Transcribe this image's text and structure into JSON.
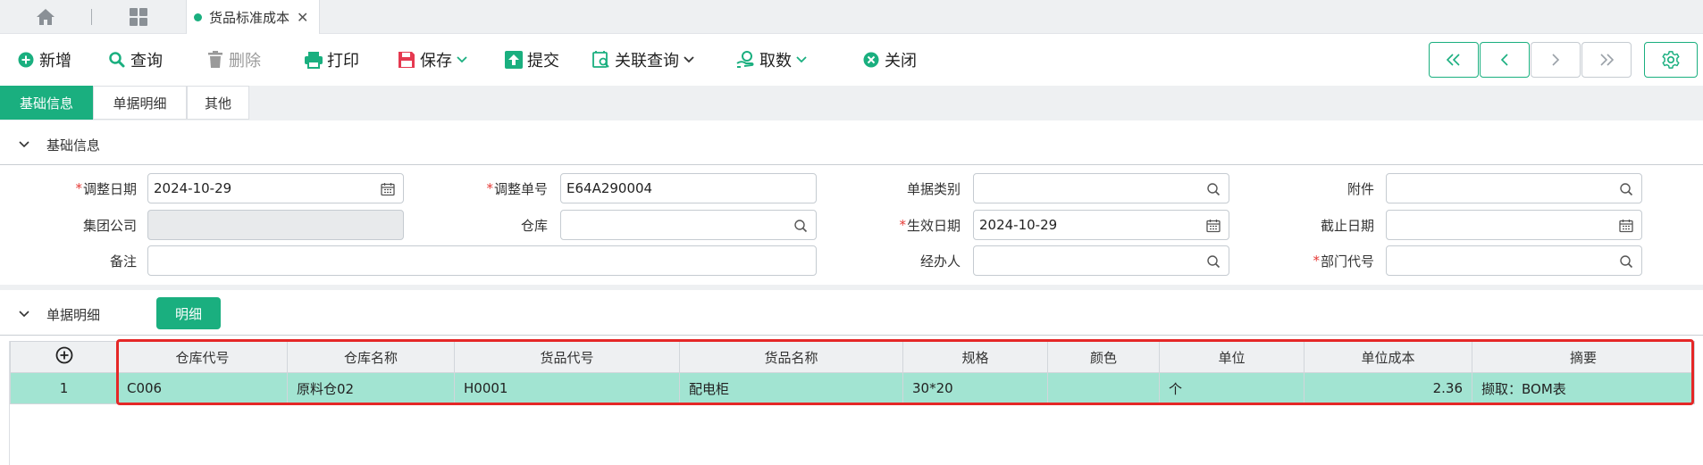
{
  "tabbar": {
    "doc_tab_label": "货品标准成本",
    "close_glyph": "✕"
  },
  "toolbar": {
    "new": "新增",
    "query": "查询",
    "delete": "删除",
    "print": "打印",
    "save": "保存",
    "submit": "提交",
    "related_query": "关联查询",
    "fetch": "取数",
    "close": "关闭"
  },
  "subtabs": [
    "基础信息",
    "单据明细",
    "其他"
  ],
  "sections": {
    "basic": "基础信息",
    "detail": "单据明细",
    "detail_tab": "明细"
  },
  "form": {
    "adjust_date": {
      "label": "调整日期",
      "value": "2024-10-29",
      "required": true
    },
    "adjust_no": {
      "label": "调整单号",
      "value": "E64A290004",
      "required": true
    },
    "doc_type": {
      "label": "单据类别",
      "value": ""
    },
    "attachment": {
      "label": "附件",
      "value": ""
    },
    "group_company": {
      "label": "集团公司",
      "value": ""
    },
    "warehouse": {
      "label": "仓库",
      "value": ""
    },
    "effective_date": {
      "label": "生效日期",
      "value": "2024-10-29",
      "required": true
    },
    "end_date": {
      "label": "截止日期",
      "value": ""
    },
    "remark": {
      "label": "备注",
      "value": ""
    },
    "handler": {
      "label": "经办人",
      "value": ""
    },
    "dept_code": {
      "label": "部门代号",
      "value": "",
      "required": true
    },
    "required_mark": "*"
  },
  "table": {
    "columns": [
      "仓库代号",
      "仓库名称",
      "货品代号",
      "货品名称",
      "规格",
      "颜色",
      "单位",
      "单位成本",
      "摘要"
    ],
    "rows": [
      {
        "index": "1",
        "wh_code": "C006",
        "wh_name": "原料仓02",
        "item_code": "H0001",
        "item_name": "配电柜",
        "spec": "30*20",
        "color": "",
        "unit": "个",
        "unit_cost": "2.36",
        "summary": "撷取：BOM表"
      }
    ]
  },
  "colors": {
    "accent": "#1aaf7f",
    "selected_row": "#a2e4d2",
    "highlight_box": "#e52727",
    "required": "#e53935"
  }
}
